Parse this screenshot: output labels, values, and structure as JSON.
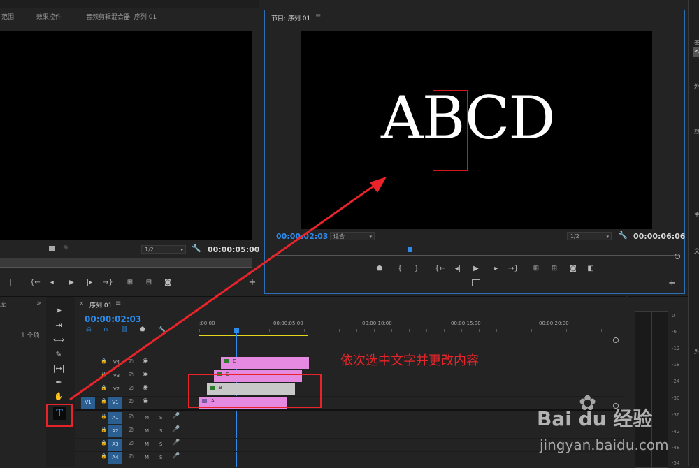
{
  "source_monitor": {
    "tabs": [
      "范围",
      "效果控件",
      "音频剪辑混合器: 序列 01"
    ],
    "zoom": "1/2",
    "timecode": "00:00:05:00"
  },
  "program_monitor": {
    "title": "节目: 序列 01",
    "menu_icon": "≡",
    "timecode_current": "00:00:02:03",
    "fit": "适合",
    "zoom": "1/2",
    "timecode_duration": "00:00:06:06",
    "video_text": [
      "A",
      "B",
      "C",
      "D"
    ]
  },
  "project_panel": {
    "tab": "库",
    "more": "»",
    "items_count": "1 个项"
  },
  "timeline": {
    "tab_close": "×",
    "tab_title": "序列 01",
    "tab_menu": "≡",
    "timecode": "00:00:02:03",
    "ruler_labels": [
      ":00:00",
      "00:00:05:00",
      "00:00:10:00",
      "00:00:15:00",
      "00:00:20:00"
    ],
    "video_tracks": [
      {
        "name": "V4",
        "clip": "D"
      },
      {
        "name": "V3",
        "clip": "C"
      },
      {
        "name": "V2",
        "clip": "B"
      },
      {
        "name": "V1",
        "clip": "A",
        "source": "V1"
      }
    ],
    "audio_tracks": [
      {
        "name": "A1",
        "m": "M",
        "s": "S"
      },
      {
        "name": "A2",
        "m": "M",
        "s": "S"
      },
      {
        "name": "A3",
        "m": "M",
        "s": "S"
      },
      {
        "name": "A4",
        "m": "M",
        "s": "S"
      }
    ]
  },
  "annotation": {
    "text": "依次选中文字并更改内容",
    "color": "#e8242a"
  },
  "audio_meter": {
    "ticks": [
      "0",
      "-6",
      "-12",
      "-18",
      "-24",
      "-30",
      "-36",
      "-42",
      "-48",
      "-54"
    ]
  },
  "right_strip": {
    "chars": [
      "基",
      "<",
      "外",
      "效",
      "主",
      "文",
      "外"
    ]
  },
  "watermark": {
    "logo": "Bai du 经验",
    "url": "jingyan.baidu.com"
  },
  "colors": {
    "playhead": "#2d8ceb",
    "clip_pink": "#e58ae0",
    "clip_gray": "#c8c8c8",
    "track_target": "#2b5f91"
  }
}
